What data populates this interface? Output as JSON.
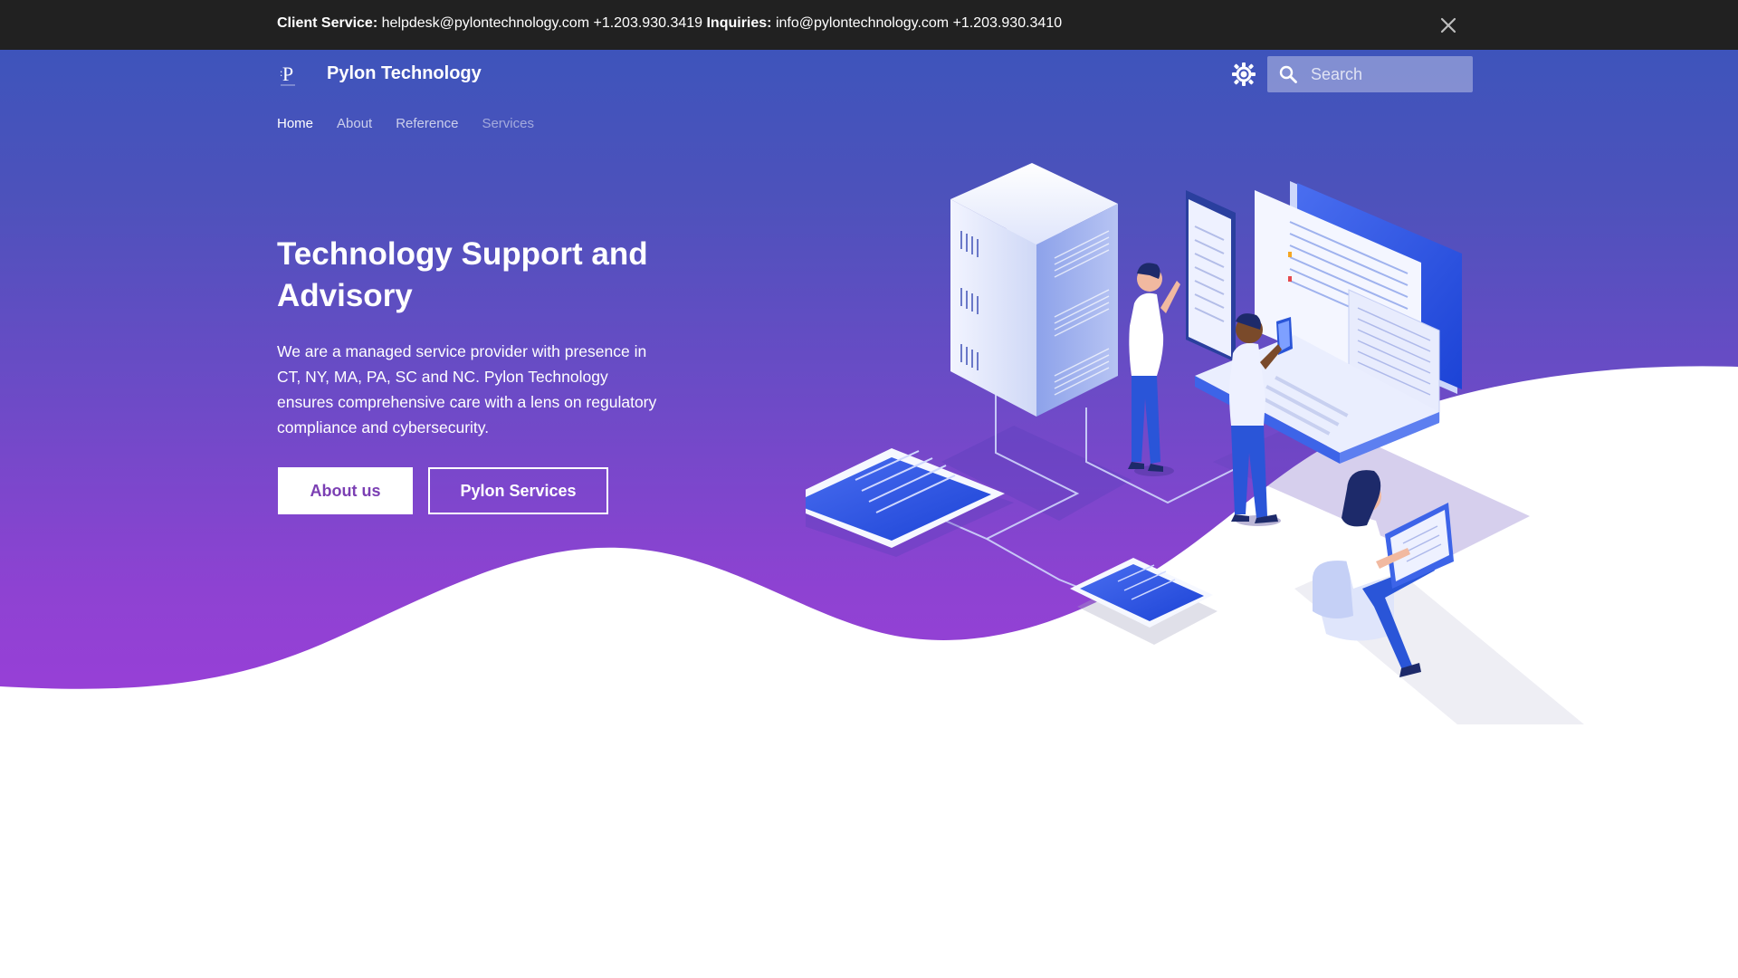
{
  "announcement": {
    "client_label": "Client Service:",
    "client_value": "helpdesk@pylontechnology.com +1.203.930.3419",
    "inquiries_label": "Inquiries:",
    "inquiries_value": "info@pylontechnology.com +1.203.930.3410"
  },
  "header": {
    "brand": "Pylon Technology",
    "search_placeholder": "Search"
  },
  "nav": {
    "items": [
      {
        "label": "Home"
      },
      {
        "label": "About"
      },
      {
        "label": "Reference"
      },
      {
        "label": "Services"
      }
    ]
  },
  "hero": {
    "title": "Technology Support and Advisory",
    "description": "We are a managed service provider with presence in CT, NY, MA, PA, SC and NC. Pylon Technology ensures comprehensive care with a lens on regulatory compliance and cybersecurity.",
    "primary_button": "About us",
    "secondary_button": "Pylon Services"
  },
  "icons": {
    "close": "close-icon",
    "theme": "sun-icon",
    "search": "search-icon",
    "logo": "pylon-logo"
  },
  "colors": {
    "announcement_bg": "#212121",
    "hero_top": "#3e54bb",
    "hero_bottom": "#9a3fd8",
    "primary_button_text": "#7b3fb3"
  }
}
